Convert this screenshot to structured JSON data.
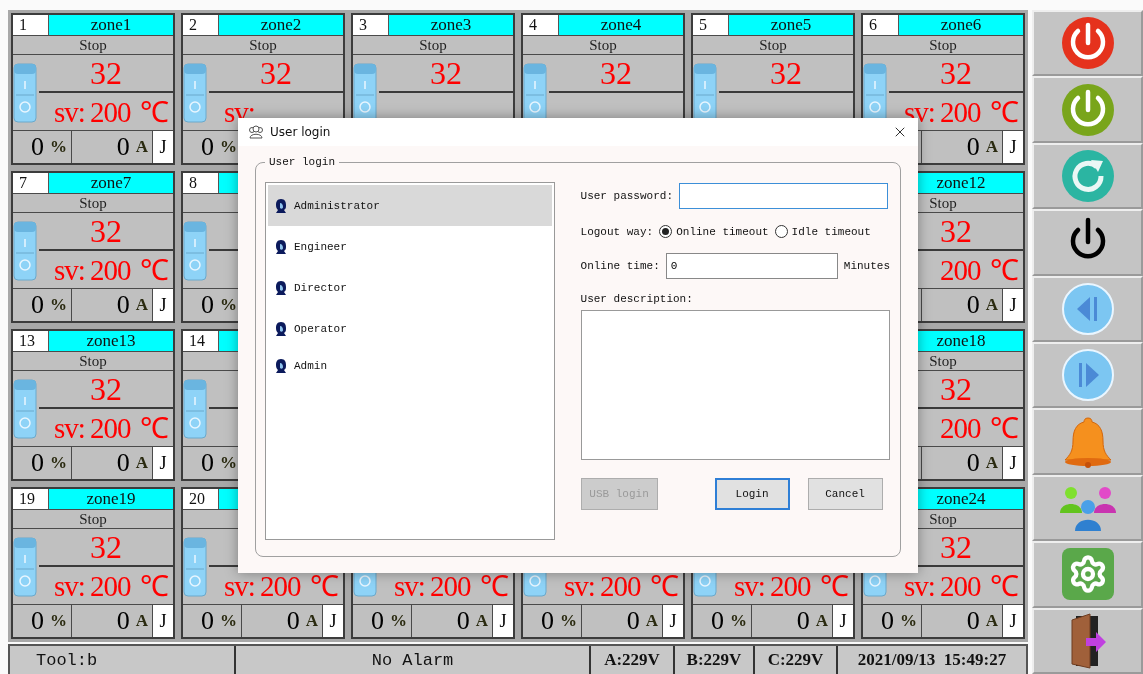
{
  "zone_rows": [
    [
      {
        "number": "1",
        "name": "zone1",
        "status": "Stop",
        "pv": "32",
        "sv_label": "sv:",
        "sv_value": "200",
        "sv_unit": "℃",
        "output": "0",
        "output_unit": "%",
        "current": "0",
        "current_unit": "A",
        "type": "J"
      },
      {
        "number": "2",
        "name": "zone2",
        "status": "Stop",
        "pv": "32",
        "sv_label": "sv:",
        "output": "0",
        "output_unit": "%"
      },
      {
        "number": "3",
        "name": "zone3",
        "status": "Stop",
        "pv": "32"
      },
      {
        "number": "4",
        "name": "zone4",
        "status": "Stop",
        "pv": "32"
      },
      {
        "number": "5",
        "name": "zone5",
        "status": "Stop",
        "pv": "32"
      },
      {
        "number": "6",
        "name": "zone6",
        "status": "Stop",
        "pv": "32",
        "sv_label": "sv:",
        "sv_value": "200",
        "sv_unit": "℃",
        "current": "0",
        "current_unit": "A",
        "type": "J"
      }
    ],
    [
      {
        "number": "7",
        "name": "zone7",
        "status": "Stop",
        "pv": "32",
        "sv_label": "sv:",
        "sv_value": "200",
        "sv_unit": "℃",
        "output": "0",
        "output_unit": "%",
        "current": "0",
        "current_unit": "A",
        "type": "J"
      },
      {
        "number": "8",
        "output": "0",
        "output_unit": "%"
      },
      {
        "name": "zone12",
        "status": "Stop",
        "pv": "32",
        "sv_value": "200",
        "sv_unit": "℃",
        "current": "0",
        "current_unit": "A",
        "type": "J"
      }
    ],
    [
      {
        "number": "13",
        "name": "zone13",
        "status": "Stop",
        "pv": "32",
        "sv_label": "sv:",
        "sv_value": "200",
        "sv_unit": "℃",
        "output": "0",
        "output_unit": "%",
        "current": "0",
        "current_unit": "A",
        "type": "J"
      },
      {
        "number": "14",
        "output": "0",
        "output_unit": "%"
      },
      {
        "name": "zone18",
        "status": "Stop",
        "pv": "32",
        "sv_value": "200",
        "sv_unit": "℃",
        "current": "0",
        "current_unit": "A",
        "type": "J"
      }
    ],
    [
      {
        "number": "19",
        "name": "zone19",
        "status": "Stop",
        "pv": "32",
        "sv_label": "sv:",
        "sv_value": "200",
        "sv_unit": "℃",
        "output": "0",
        "output_unit": "%",
        "current": "0",
        "current_unit": "A",
        "type": "J"
      },
      {
        "number": "20",
        "sv_label": "sv:",
        "sv_value": "200",
        "sv_unit": "℃",
        "output": "0",
        "output_unit": "%",
        "current": "0",
        "current_unit": "A",
        "type": "J"
      },
      {
        "sv_label": "sv:",
        "sv_value": "200",
        "sv_unit": "℃",
        "output": "0",
        "output_unit": "%",
        "current": "0",
        "current_unit": "A",
        "type": "J"
      },
      {
        "sv_label": "sv:",
        "sv_value": "200",
        "sv_unit": "℃",
        "output": "0",
        "output_unit": "%",
        "current": "0",
        "current_unit": "A",
        "type": "J"
      },
      {
        "sv_label": "sv:",
        "sv_value": "200",
        "sv_unit": "℃",
        "output": "0",
        "output_unit": "%",
        "current": "0",
        "current_unit": "A",
        "type": "J"
      },
      {
        "name": "zone24",
        "status": "Stop",
        "pv": "32",
        "sv_label": "sv:",
        "sv_value": "200",
        "sv_unit": "℃",
        "output": "0",
        "output_unit": "%",
        "current": "0",
        "current_unit": "A",
        "type": "J"
      }
    ]
  ],
  "status_bar": {
    "tool": "Tool:b",
    "alarm": "No Alarm",
    "phase_a": "A:229V",
    "phase_b": "B:229V",
    "phase_c": "C:229V",
    "datetime": "2021/09/13  15:49:27"
  },
  "side_buttons": [
    {
      "kind": "stop"
    },
    {
      "kind": "start"
    },
    {
      "kind": "reset"
    },
    {
      "kind": "power"
    },
    {
      "kind": "prev"
    },
    {
      "kind": "next"
    },
    {
      "kind": "alarm"
    },
    {
      "kind": "users"
    },
    {
      "kind": "settings"
    },
    {
      "kind": "exit"
    }
  ],
  "login_dialog": {
    "title": "User login",
    "group_title": "User login",
    "users": [
      {
        "name": "Administrator",
        "selected": true
      },
      {
        "name": "Engineer",
        "selected": false
      },
      {
        "name": "Director",
        "selected": false
      },
      {
        "name": "Operator",
        "selected": false
      },
      {
        "name": "Admin",
        "selected": false
      }
    ],
    "password_label": "User password:",
    "password_focused": true,
    "logout_label": "Logout way:",
    "logout_options": [
      {
        "label": "Online timeout",
        "selected": true
      },
      {
        "label": "Idle timeout",
        "selected": false
      }
    ],
    "online_time_label": "Online time:",
    "online_time": "0",
    "online_time_unit": "Minutes",
    "description_label": "User description:",
    "buttons": [
      {
        "label": "USB login",
        "disabled": true,
        "default": false
      },
      {
        "label": "Login",
        "disabled": false,
        "default": true
      },
      {
        "label": "Cancel",
        "disabled": false,
        "default": false
      }
    ]
  }
}
